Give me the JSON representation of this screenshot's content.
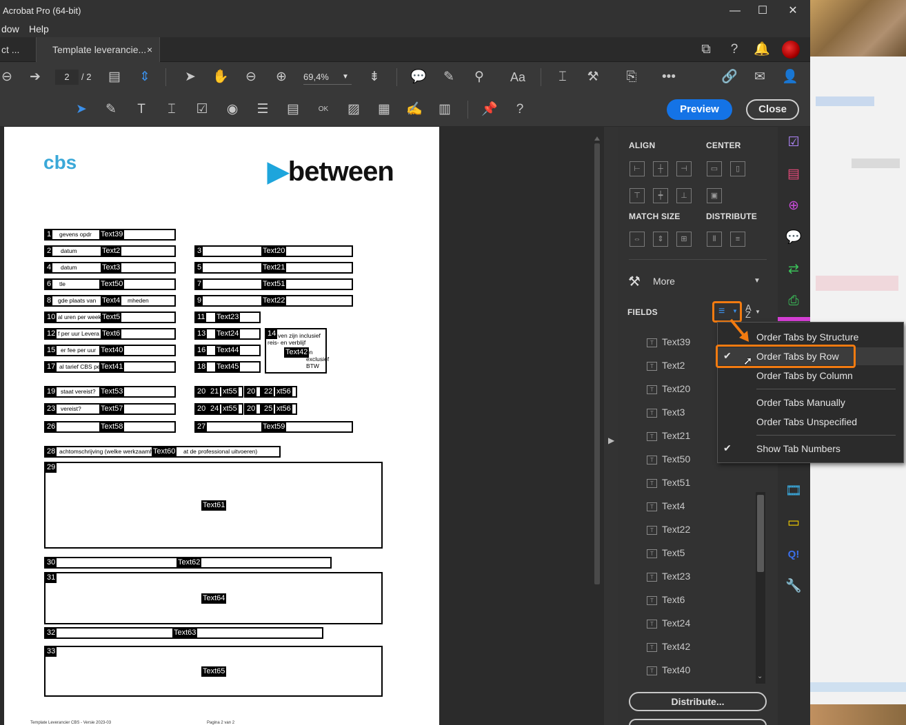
{
  "window": {
    "title": "Acrobat Pro (64-bit)",
    "min": "—",
    "max": "☐",
    "close": "✕"
  },
  "menubar": {
    "items": [
      "dow",
      "Help"
    ]
  },
  "tabs": [
    {
      "label": "ct ..."
    },
    {
      "label": "Template leverancie...",
      "close": "×"
    }
  ],
  "toolbar": {
    "page_current": "2",
    "page_total": "/ 2",
    "zoom": "69,4%",
    "preview": "Preview",
    "close": "Close"
  },
  "document": {
    "logo_left": "cbs",
    "logo_right": "between",
    "footer_left": "Template Leverancier CBS - Versie 2023-03",
    "footer_right": "Pagina 2 van 2",
    "fields": [
      {
        "num": "1",
        "label": "gevens opdr",
        "name": "Text39"
      },
      {
        "num": "2",
        "label": "datum",
        "name": "Text2"
      },
      {
        "num": "3",
        "label": "",
        "name": "Text20"
      },
      {
        "num": "4",
        "label": "datum",
        "name": "Text3"
      },
      {
        "num": "5",
        "label": "",
        "name": "Text21"
      },
      {
        "num": "6",
        "label": "tle",
        "name": "Text50"
      },
      {
        "num": "7",
        "label": "",
        "name": "Text51"
      },
      {
        "num": "8",
        "label": "gde plaats van",
        "name": "Text4",
        "suffix": "mheden"
      },
      {
        "num": "9",
        "label": "",
        "name": "Text22"
      },
      {
        "num": "10",
        "label": "al uren per week",
        "name": "Text5"
      },
      {
        "num": "11",
        "label": "",
        "name": "Text23"
      },
      {
        "num": "12",
        "label": "f per uur Levera",
        "name": "Text6"
      },
      {
        "num": "13",
        "label": "",
        "name": "Text24"
      },
      {
        "num": "14",
        "label": "ven zijn inclusief reis- en verblijf",
        "name": "Text42",
        "suffix": "en exclusief BTW"
      },
      {
        "num": "15",
        "label": "er fee per uur",
        "name": "Text40"
      },
      {
        "num": "16",
        "label": "",
        "name": "Text44"
      },
      {
        "num": "17",
        "label": "al tarief CBS pe",
        "name": "Text41"
      },
      {
        "num": "18",
        "label": "",
        "name": "Text45"
      },
      {
        "num": "19",
        "label": "staat vereist?",
        "name": "Text53"
      },
      {
        "num": "20",
        "label": "",
        "name": ""
      },
      {
        "num": "21",
        "label": "",
        "name": "xt55"
      },
      {
        "num": "20",
        "label": "",
        "name": ""
      },
      {
        "num": "22",
        "label": "",
        "name": "xt56"
      },
      {
        "num": "23",
        "label": "vereist?",
        "name": "Text57"
      },
      {
        "num": "20",
        "label": "",
        "name": ""
      },
      {
        "num": "24",
        "label": "",
        "name": "xt55"
      },
      {
        "num": "20",
        "label": "",
        "name": ""
      },
      {
        "num": "25",
        "label": "",
        "name": "xt56"
      },
      {
        "num": "26",
        "label": "",
        "name": "Text58"
      },
      {
        "num": "27",
        "label": "",
        "name": "Text59"
      },
      {
        "num": "28",
        "label": "achtomschrijving (welke werkzaamh",
        "name": "Text60",
        "suffix": "at de professional uitvoeren)"
      },
      {
        "num": "29",
        "label": "",
        "name": "Text61"
      },
      {
        "num": "30",
        "label": "",
        "name": "Text62"
      },
      {
        "num": "31",
        "label": "",
        "name": "Text64"
      },
      {
        "num": "32",
        "label": "",
        "name": "Text63"
      },
      {
        "num": "33",
        "label": "",
        "name": "Text65"
      }
    ]
  },
  "panel": {
    "align": "ALIGN",
    "center": "CENTER",
    "match_size": "MATCH SIZE",
    "distribute": "DISTRIBUTE",
    "more": "More",
    "fields": "FIELDS",
    "field_list": [
      "Text39",
      "Text2",
      "Text20",
      "Text3",
      "Text21",
      "Text50",
      "Text51",
      "Text4",
      "Text22",
      "Text5",
      "Text23",
      "Text6",
      "Text24",
      "Text42",
      "Text40"
    ],
    "distribute_btn": "Distribute..."
  },
  "context_menu": {
    "items": [
      {
        "label": "Order Tabs by Structure",
        "checked": false
      },
      {
        "label": "Order Tabs by Row",
        "checked": true
      },
      {
        "label": "Order Tabs by Column",
        "checked": false
      },
      {
        "label": "Order Tabs Manually",
        "checked": false
      },
      {
        "label": "Order Tabs Unspecified",
        "checked": false
      },
      {
        "label": "Show Tab Numbers",
        "checked": true
      }
    ]
  },
  "colors": {
    "accent": "#1473e6",
    "highlight": "#f37b10",
    "panel": "#323232",
    "chrome": "#383838"
  },
  "icons": {
    "check": "✔"
  }
}
